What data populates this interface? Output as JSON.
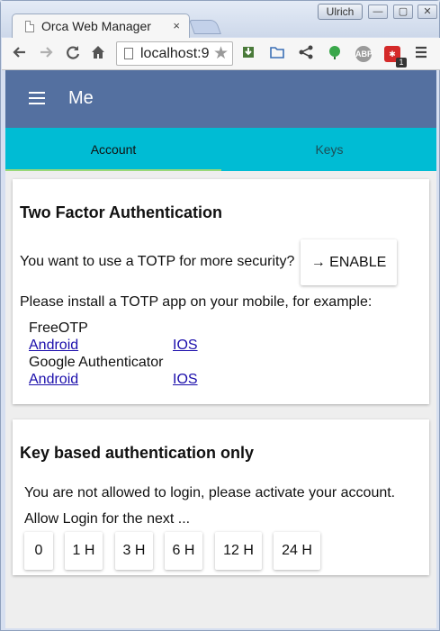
{
  "browser": {
    "tab_title": "Orca Web Manager",
    "tab_close": "×",
    "profile": "Ulrich",
    "win_minimize": "—",
    "win_maximize": "▢",
    "win_close": "✕",
    "url": "localhost:9",
    "extensions": {
      "abp": "ABP",
      "badge": "1"
    }
  },
  "app": {
    "title": "Me"
  },
  "tabs": [
    {
      "label": "Account"
    },
    {
      "label": "Keys"
    }
  ],
  "totp_card": {
    "title": "Two Factor Authentication",
    "prompt": "You want to use a TOTP for more security?",
    "enable_label": "→ ENABLE",
    "install_text": "Please install a TOTP app on your mobile, for example:",
    "apps": [
      {
        "name": "FreeOTP",
        "android": "Android",
        "ios": "IOS"
      },
      {
        "name": "Google Authenticator",
        "android": "Android",
        "ios": "IOS"
      }
    ]
  },
  "key_card": {
    "title": "Key based authentication only",
    "notice": "You are not allowed to login, please activate your account.",
    "allow_label": "Allow Login for the next ...",
    "durations": [
      "0",
      "1 H",
      "3 H",
      "6 H",
      "12 H",
      "24 H"
    ]
  }
}
